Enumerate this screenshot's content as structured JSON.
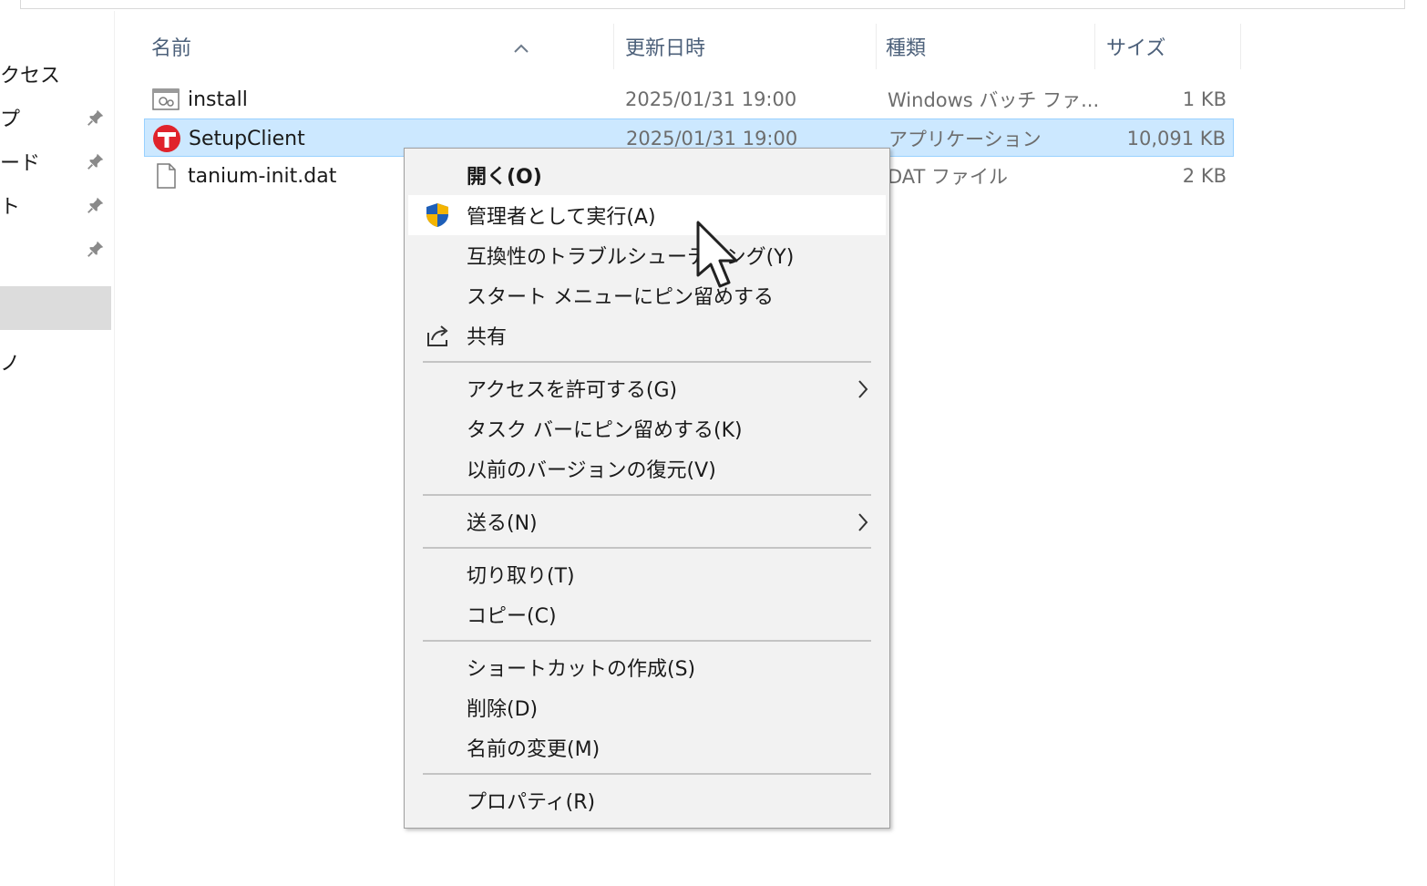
{
  "nav": {
    "items": [
      {
        "label": "クセス",
        "pinned": false
      },
      {
        "label": "プ",
        "pinned": true
      },
      {
        "label": "ード",
        "pinned": true
      },
      {
        "label": "ト",
        "pinned": true
      },
      {
        "label": "",
        "pinned": true
      },
      {
        "label": "",
        "pinned": false,
        "selected": true
      },
      {
        "label": "ノ",
        "pinned": false
      }
    ]
  },
  "columns": {
    "name": "名前",
    "modified": "更新日時",
    "type": "種類",
    "size": "サイズ"
  },
  "files": [
    {
      "name": "install",
      "modified": "2025/01/31 19:00",
      "type": "Windows バッチ ファ...",
      "size": "1 KB",
      "icon": "batch-file-icon",
      "selected": false
    },
    {
      "name": "SetupClient",
      "modified": "2025/01/31 19:00",
      "type": "アプリケーション",
      "size": "10,091 KB",
      "icon": "tanium-app-icon",
      "selected": true
    },
    {
      "name": "tanium-init.dat",
      "modified": "",
      "type": "DAT ファイル",
      "size": "2 KB",
      "icon": "blank-file-icon",
      "selected": false
    }
  ],
  "context_menu": {
    "open": "開く(O)",
    "run_as_admin": "管理者として実行(A)",
    "troubleshoot": "互換性のトラブルシューティング(Y)",
    "pin_start": "スタート メニューにピン留めする",
    "share": "共有",
    "grant_access": "アクセスを許可する(G)",
    "pin_taskbar": "タスク バーにピン留めする(K)",
    "restore_versions": "以前のバージョンの復元(V)",
    "send_to": "送る(N)",
    "cut": "切り取り(T)",
    "copy": "コピー(C)",
    "create_shortcut": "ショートカットの作成(S)",
    "delete": "削除(D)",
    "rename": "名前の変更(M)",
    "properties": "プロパティ(R)"
  },
  "colors": {
    "selection_bg": "#cce8ff",
    "selection_border": "#99d1ff",
    "menu_bg": "#f2f2f2",
    "header_text": "#4c607a",
    "tanium_red": "#e0232b"
  }
}
